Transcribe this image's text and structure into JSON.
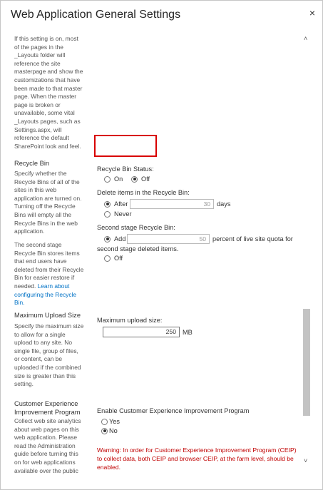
{
  "dialog": {
    "title": "Web Application General Settings",
    "close_label": "×"
  },
  "master_page_text": "If this setting is on, most of the pages in the _Layouts folder will reference the site masterpage and show the customizations that have been made to that master page. When the master page is broken or unavailable, some vital _Layouts pages, such as Settings.aspx, will reference the default SharePoint look and feel.",
  "recycle_bin": {
    "title": "Recycle Bin",
    "desc1": "Specify whether the Recycle Bins of all of the sites in this web application are turned on. Turning off the Recycle Bins will empty all the Recycle Bins in the web application.",
    "desc2_prefix": "The second stage Recycle Bin stores items that end users have deleted from their Recycle Bin for easier restore if needed. ",
    "desc2_link": "Learn about configuring the Recycle Bin.",
    "status_label": "Recycle Bin Status:",
    "on_label": "On",
    "off_label": "Off",
    "delete_label": "Delete items in the Recycle Bin:",
    "after_label": "After",
    "after_value": "30",
    "days_label": "days",
    "never_label": "Never",
    "second_stage_label": "Second stage Recycle Bin:",
    "add_label": "Add",
    "add_value": "50",
    "percent_label": "percent of live site quota for",
    "second_stage_deleted": "second stage deleted items.",
    "off2_label": "Off"
  },
  "upload": {
    "title": "Maximum Upload Size",
    "desc": "Specify the maximum size to allow for a single upload to any site. No single file, group of files, or content, can be uploaded if the combined size is greater than this setting.",
    "label": "Maximum upload size:",
    "value": "250",
    "unit": "MB"
  },
  "ceip": {
    "title": "Customer Experience Improvement Program",
    "desc": "Collect web site analytics about web pages on this web application. Please read the Administration guide before turning this on for web applications available over the public",
    "enable_label": "Enable Customer Experience Improvement Program",
    "yes_label": "Yes",
    "no_label": "No",
    "warning": "Warning: In order for Customer Experience Improvement Program (CEIP) to collect data, both CEIP and browser CEIP, at the farm level, should be enabled."
  },
  "colors": {
    "highlight_box": "#d80000",
    "warning_text": "#c00000",
    "link": "#0072c6"
  }
}
